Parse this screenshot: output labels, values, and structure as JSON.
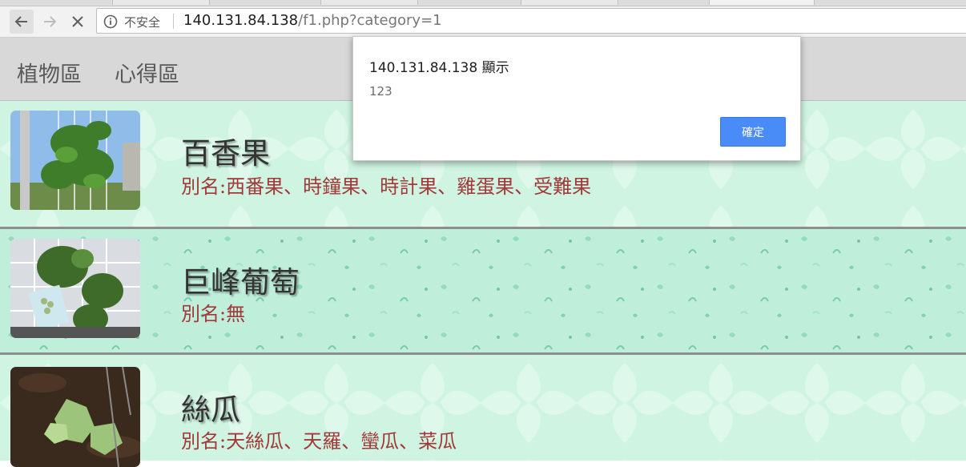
{
  "browser": {
    "security_label": "不安全",
    "url_host": "140.131.84.138",
    "url_rest": "/f1.php?category=1",
    "back_icon": "back-arrow-icon",
    "forward_icon": "forward-arrow-icon",
    "stop_icon": "close-icon",
    "info_icon": "info-icon"
  },
  "site_nav": {
    "items": [
      {
        "label": "植物區"
      },
      {
        "label": "心得區"
      }
    ]
  },
  "plants": [
    {
      "name": "百香果",
      "alias": "別名:西番果、時鐘果、時計果、雞蛋果、受難果"
    },
    {
      "name": "巨峰葡萄",
      "alias": "別名:無"
    },
    {
      "name": "絲瓜",
      "alias": "別名:天絲瓜、天羅、蠻瓜、菜瓜"
    }
  ],
  "alert": {
    "title": "140.131.84.138 顯示",
    "message": "123",
    "ok_label": "確定"
  },
  "colors": {
    "row_bg": "#cff5e2",
    "row_bg_alt": "#bfeedb",
    "title_text": "#333333",
    "alias_text": "#a23838",
    "ok_button": "#4a8cf7"
  }
}
